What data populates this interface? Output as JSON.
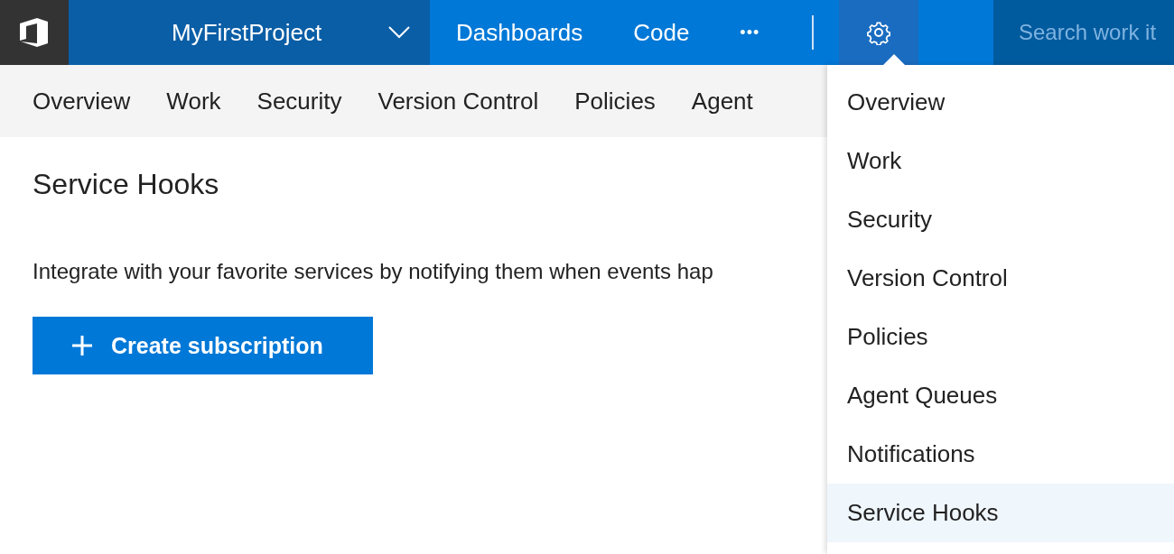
{
  "top_bar": {
    "project": "MyFirstProject",
    "nav": [
      {
        "label": "Dashboards"
      },
      {
        "label": "Code"
      }
    ],
    "more": "•••",
    "settings": {
      "selected": true
    },
    "search": {
      "placeholder": "Search work it"
    }
  },
  "sub_nav": [
    {
      "label": "Overview"
    },
    {
      "label": "Work"
    },
    {
      "label": "Security"
    },
    {
      "label": "Version Control"
    },
    {
      "label": "Policies"
    },
    {
      "label": "Agent"
    }
  ],
  "page": {
    "title": "Service Hooks",
    "description": "Integrate with your favorite services by notifying them when events hap",
    "button": "Create subscription"
  },
  "settings_menu": [
    {
      "label": "Overview",
      "selected": false
    },
    {
      "label": "Work",
      "selected": false
    },
    {
      "label": "Security",
      "selected": false
    },
    {
      "label": "Version Control",
      "selected": false
    },
    {
      "label": "Policies",
      "selected": false
    },
    {
      "label": "Agent Queues",
      "selected": false
    },
    {
      "label": "Notifications",
      "selected": false
    },
    {
      "label": "Service Hooks",
      "selected": true
    }
  ]
}
